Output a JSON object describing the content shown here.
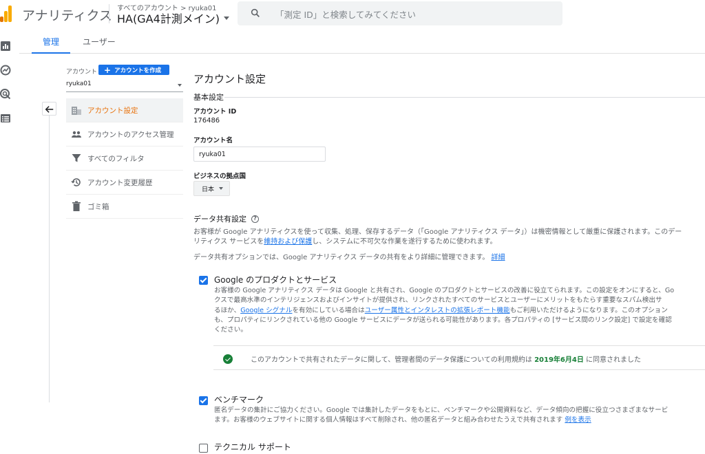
{
  "header": {
    "app_title": "アナリティクス",
    "breadcrumb": "すべてのアカウント > ryuka01",
    "property_name": "HA(GA4計測メイン)",
    "search_placeholder": "「測定 ID」と検索してみてください"
  },
  "rail": {
    "icons": [
      "reports-icon",
      "explore-icon",
      "advertising-icon",
      "configure-icon"
    ]
  },
  "tabs": [
    {
      "label": "管理",
      "active": true
    },
    {
      "label": "ユーザー",
      "active": false
    }
  ],
  "account_panel": {
    "label": "アカウント",
    "create_button": "アカウントを作成",
    "selected_account": "ryuka01",
    "menu": [
      {
        "label": "アカウント設定",
        "icon": "building-icon",
        "active": true
      },
      {
        "label": "アカウントのアクセス管理",
        "icon": "people-icon",
        "active": false
      },
      {
        "label": "すべてのフィルタ",
        "icon": "filter-icon",
        "active": false
      },
      {
        "label": "アカウント変更履歴",
        "icon": "history-icon",
        "active": false
      },
      {
        "label": "ゴミ箱",
        "icon": "trash-icon",
        "active": false
      }
    ]
  },
  "main": {
    "title": "アカウント設定",
    "basic_section": "基本設定",
    "account_id_label": "アカウント ID",
    "account_id": "176486",
    "account_name_label": "アカウント名",
    "account_name": "ryuka01",
    "country_label": "ビジネスの拠点国",
    "country": "日本",
    "data_sharing_title": "データ共有設定",
    "para1_line1": "お客様が Google アナリティクスを使って収集、処理、保存するデータ（「Google アナリティクス データ」）は機密情報として厳重に保護されます。このデー",
    "para1_line2_pre": "リティクス サービスを",
    "para1_link": "維持および保護",
    "para1_line2_post": "し、システムに不可欠な作業を遂行するために使われます。",
    "para2": "データ共有オプションでは、Google アナリティクス データの共有をより詳細に管理できます。",
    "para2_link": "詳細",
    "option_google": {
      "title": "Google のプロダクトとサービス",
      "checked": true,
      "line1": "お客様の Google アナリティクス データは Google と共有され、Google のプロダクトとサービスの改善に役立てられます。この設定をオンにすると、Go",
      "line2": "クスで最高水準のインテリジェンスおよびインサイトが提供され、リンクされたすべてのサービスとユーザーにメリットをもたらす重要なスパム検出サ",
      "line3_pre": "るほか、",
      "line3_link1": "Google シグナル",
      "line3_mid": "を有効にしている場合は",
      "line3_link2": "ユーザー属性とインタレストの拡張レポート機能",
      "line3_post": "もご利用いただけるようになります。このオプション",
      "line4": "も、プロパティにリンクされている他の Google サービスにデータが送られる可能性があります。各プロパティの [サービス間のリンク設定] で設定を確認",
      "line5": "ください。"
    },
    "agreement": {
      "text_pre": "このアカウントで共有されたデータに関して、管理者間のデータ保護についての利用規約は",
      "date": "2019年6月4日",
      "text_post": "に同意されました"
    },
    "option_benchmark": {
      "title": "ベンチマーク",
      "checked": true,
      "line1": "匿名データの集計にご協力ください。Google では集計したデータをもとに、ベンチマークや公開資料など、データ傾向の把握に役立つさまざまなサービ",
      "line2": "ます。お客様のウェブサイトに関する個人情報はすべて削除され、他の匿名データと組み合わせたうえで共有されます",
      "link": "例を表示"
    },
    "option_support": {
      "title": "テクニカル サポート",
      "checked": false
    }
  }
}
